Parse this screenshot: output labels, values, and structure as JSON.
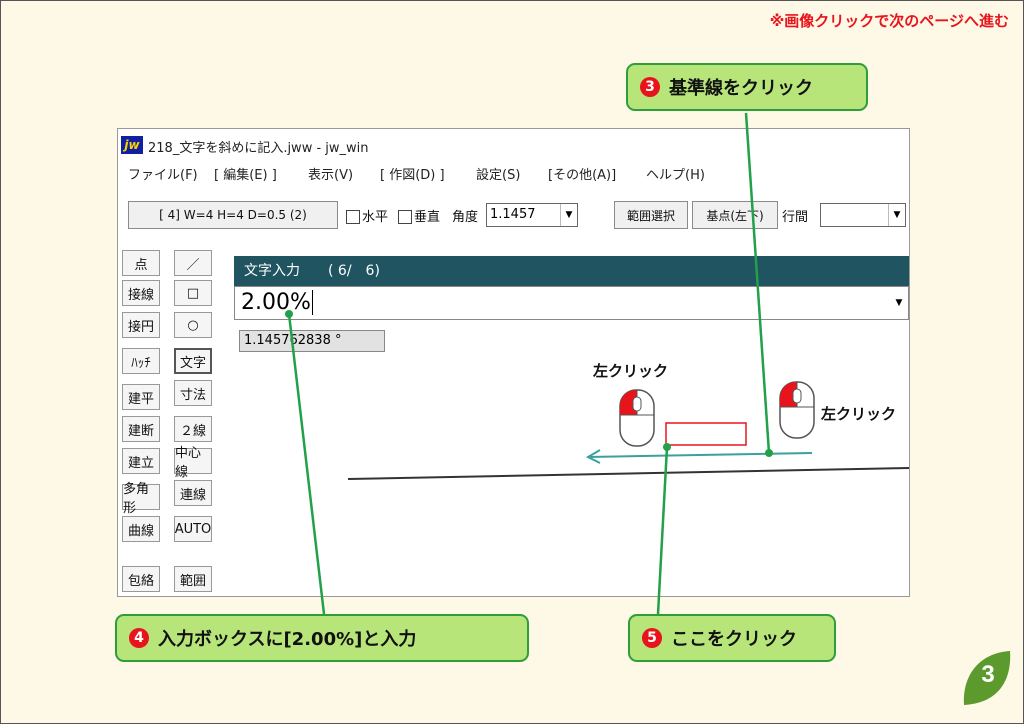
{
  "top_note": "※画像クリックで次のページへ進む",
  "callouts": {
    "step3": {
      "num": "3",
      "text": "基準線をクリック"
    },
    "step4": {
      "num": "4",
      "text": "入力ボックスに[2.00%]と入力"
    },
    "step5": {
      "num": "5",
      "text": "ここをクリック"
    }
  },
  "window": {
    "icon_text": "jw",
    "title": "218_文字を斜めに記入.jww - jw_win"
  },
  "menu": [
    "ファイル(F)",
    "[ 編集(E) ]",
    "表示(V)",
    "[ 作図(D) ]",
    "設定(S)",
    "[その他(A)]",
    "ヘルプ(H)"
  ],
  "toolbar": {
    "text_style_button": "[ 4]  W=4  H=4  D=0.5 (2)",
    "horizontal_label": "水平",
    "vertical_label": "垂直",
    "angle_label": "角度",
    "angle_value": "1.1457",
    "range_select_button": "範囲選択",
    "base_point_button": "基点(左下)",
    "line_spacing_label": "行間"
  },
  "left_tools": [
    "点",
    "接線",
    "接円",
    "ﾊｯﾁ",
    "建平",
    "建断",
    "建立",
    "多角形",
    "曲線",
    "包絡"
  ],
  "right_tools": [
    "／",
    "□",
    "○",
    "文字",
    "寸法",
    "２線",
    "中心線",
    "連線",
    "AUTO",
    "範囲"
  ],
  "dialog": {
    "title": "文字入力　　( 6/　6)",
    "input_value": "2.00%"
  },
  "angle_readout": "1.145762838 °",
  "click_labels": {
    "left": "左クリック",
    "right": "左クリック"
  },
  "page_number": "3",
  "colors": {
    "callout_fill": "#b7e57a",
    "callout_border": "#2f9d3b",
    "number_red": "#e8141c",
    "dialog_header": "#1f5460",
    "baseline_teal": "#3aa0a0",
    "page_badge": "#5c9a2e"
  }
}
